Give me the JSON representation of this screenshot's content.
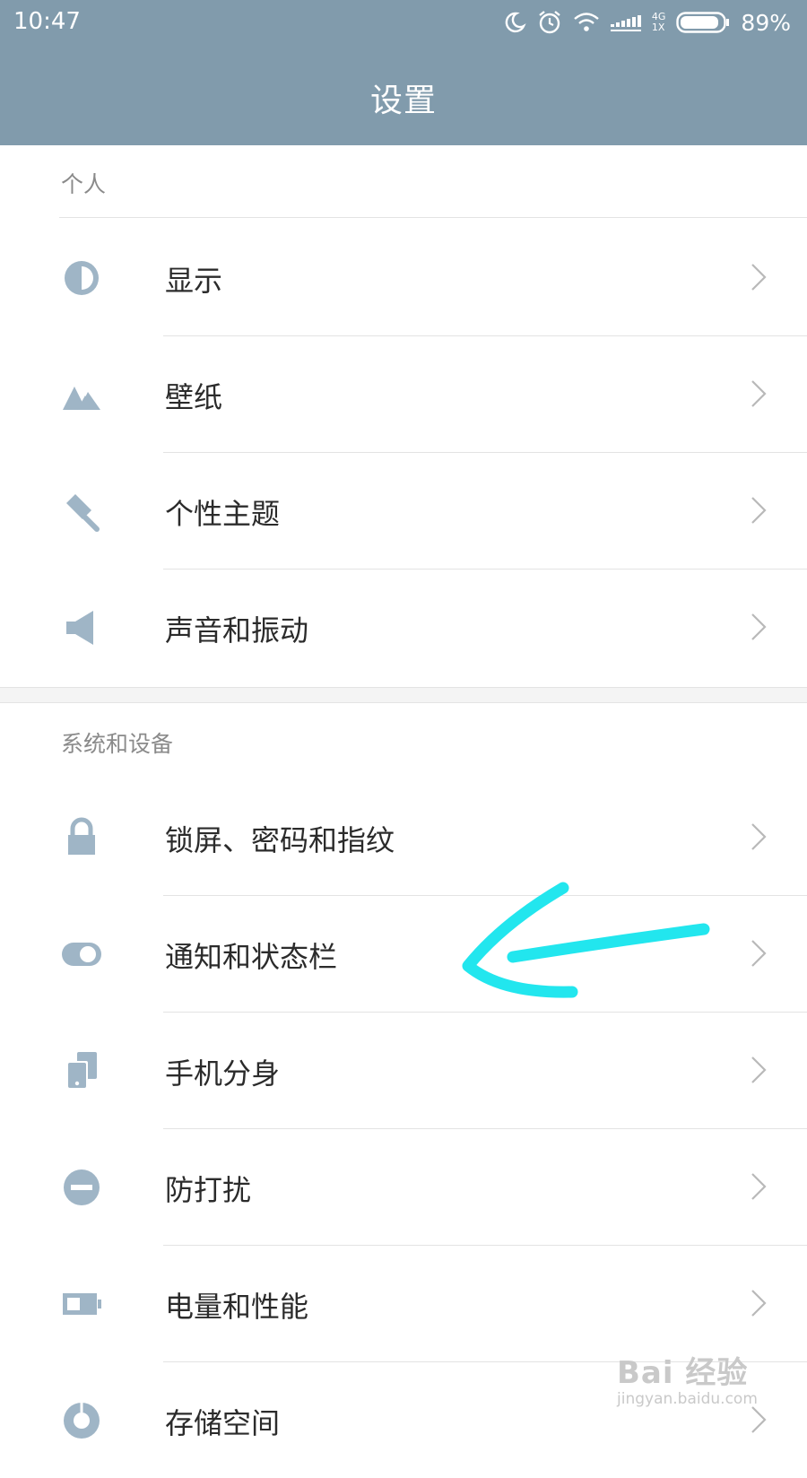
{
  "status_bar": {
    "time": "10:47",
    "icons": [
      "moon-icon",
      "alarm-icon",
      "wifi-icon",
      "signal-icon",
      "battery-icon"
    ],
    "network_top": "4G",
    "network_bottom": "1X",
    "battery_percent": "89%"
  },
  "header": {
    "title": "设置"
  },
  "sections": [
    {
      "title": "个人",
      "items": [
        {
          "label": "显示",
          "icon": "display-icon"
        },
        {
          "label": "壁纸",
          "icon": "wallpaper-icon"
        },
        {
          "label": "个性主题",
          "icon": "theme-brush-icon"
        },
        {
          "label": "声音和振动",
          "icon": "speaker-icon"
        }
      ]
    },
    {
      "title": "系统和设备",
      "items": [
        {
          "label": "锁屏、密码和指纹",
          "icon": "lock-icon"
        },
        {
          "label": "通知和状态栏",
          "icon": "toggle-icon"
        },
        {
          "label": "手机分身",
          "icon": "dual-phone-icon"
        },
        {
          "label": "防打扰",
          "icon": "do-not-disturb-icon"
        },
        {
          "label": "电量和性能",
          "icon": "battery-performance-icon"
        },
        {
          "label": "存储空间",
          "icon": "storage-icon"
        }
      ]
    }
  ],
  "watermark": {
    "main": "Bai 经验",
    "sub": "jingyan.baidu.com"
  },
  "colors": {
    "bar": "#819bac",
    "icon": "#9fb5c6",
    "annotation": "#22e6ee"
  }
}
